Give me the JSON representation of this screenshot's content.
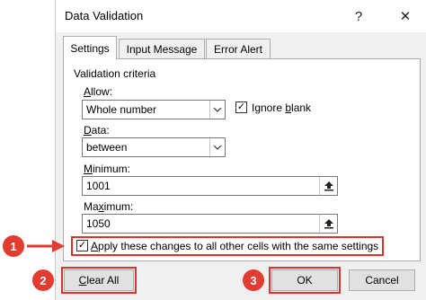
{
  "dialog": {
    "title": "Data Validation",
    "help_glyph": "?",
    "close_glyph": "✕"
  },
  "tabs": [
    {
      "label": "Settings",
      "active": true
    },
    {
      "label": "Input Message",
      "active": false
    },
    {
      "label": "Error Alert",
      "active": false
    }
  ],
  "criteria": {
    "group_label": "Validation criteria",
    "allow_label_u": "A",
    "allow_label_rest": "llow:",
    "allow_value": "Whole number",
    "ignore_blank_pre": "Ignore ",
    "ignore_blank_u": "b",
    "ignore_blank_post": "lank",
    "ignore_blank_checked": true,
    "data_label_u": "D",
    "data_label_rest": "ata:",
    "data_value": "between",
    "minimum_label_u": "M",
    "minimum_label_rest": "inimum:",
    "minimum_value": "1001",
    "maximum_label_pre": "Ma",
    "maximum_label_u": "x",
    "maximum_label_rest": "imum:",
    "maximum_value": "1050"
  },
  "apply_all": {
    "checked": true,
    "label_u": "A",
    "label_rest": "pply these changes to all other cells with the same settings"
  },
  "buttons": {
    "clear_all_u": "C",
    "clear_all_rest": "lear All",
    "ok": "OK",
    "cancel": "Cancel"
  },
  "callouts": [
    "1",
    "2",
    "3"
  ],
  "colors": {
    "accent_red": "#e23b2f",
    "highlight_red": "#e0302c"
  }
}
